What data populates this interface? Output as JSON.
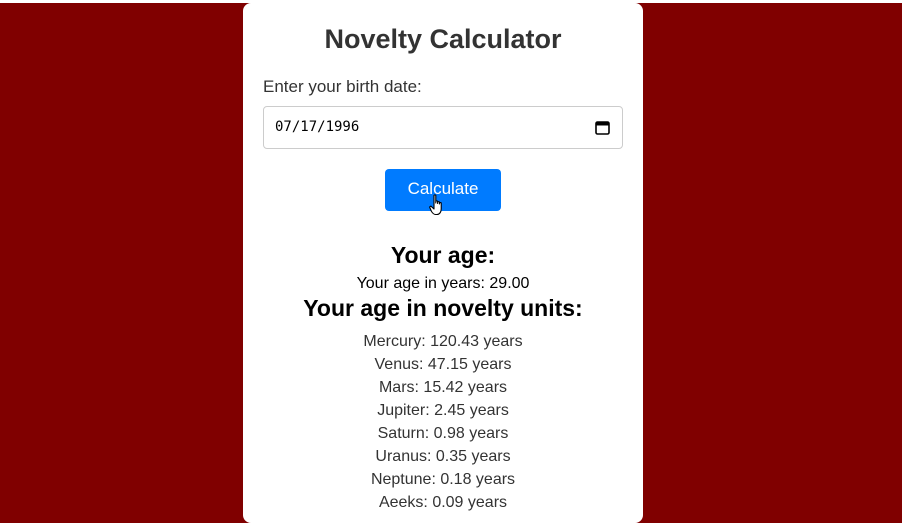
{
  "title": "Novelty Calculator",
  "birth_label": "Enter your birth date:",
  "birth_date_value": "07/17/1996",
  "calculate_label": "Calculate",
  "age_heading": "Your age:",
  "age_years_text": "Your age in years: 29.00",
  "novelty_heading": "Your age in novelty units:",
  "planets": [
    {
      "text": "Mercury: 120.43 years"
    },
    {
      "text": "Venus: 47.15 years"
    },
    {
      "text": "Mars: 15.42 years"
    },
    {
      "text": "Jupiter: 2.45 years"
    },
    {
      "text": "Saturn: 0.98 years"
    },
    {
      "text": "Uranus: 0.35 years"
    },
    {
      "text": "Neptune: 0.18 years"
    },
    {
      "text": "Aeeks: 0.09 years"
    }
  ],
  "colors": {
    "background": "#800000",
    "button": "#007bff",
    "card": "#ffffff"
  }
}
